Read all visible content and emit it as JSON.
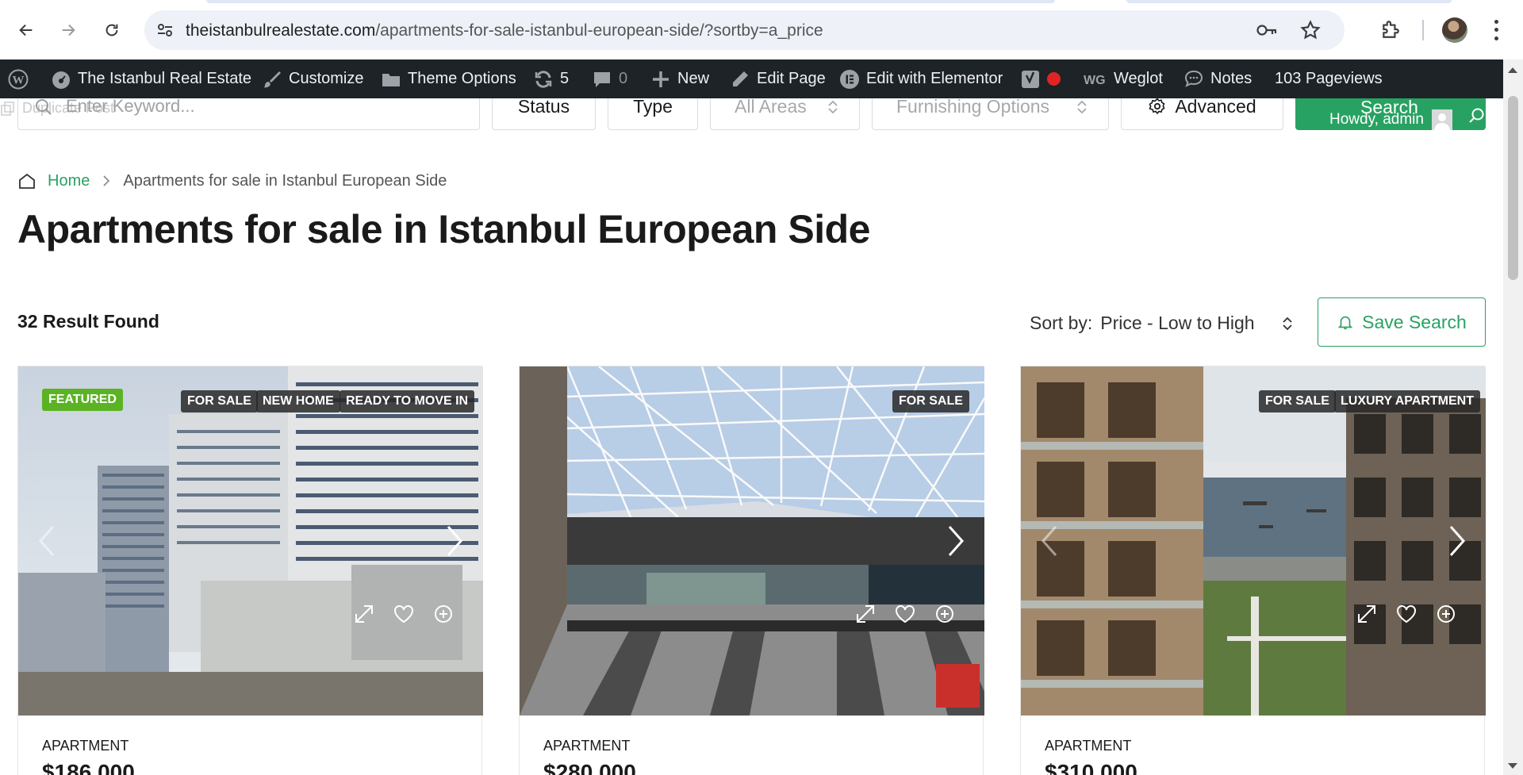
{
  "browser": {
    "url_host": "theistanbulrealestate.com",
    "url_path": "/apartments-for-sale-istanbul-european-side/?sortby=a_price"
  },
  "admin_bar": {
    "site_name": "The Istanbul Real Estate",
    "customize": "Customize",
    "theme_options": "Theme Options",
    "updates_count": "5",
    "comments_count": "0",
    "new": "New",
    "edit_page": "Edit Page",
    "edit_elementor": "Edit with Elementor",
    "weglot": "Weglot",
    "notes": "Notes",
    "pageviews": "103 Pageviews"
  },
  "search": {
    "keyword_placeholder": "Enter Keyword...",
    "duplicate_post": "Duplicate Post",
    "status": "Status",
    "type": "Type",
    "areas": "All Areas",
    "furnishing": "Furnishing Options",
    "advanced": "Advanced",
    "button": "Search",
    "howdy": "Howdy, admin"
  },
  "breadcrumb": {
    "home": "Home",
    "current": "Apartments for sale in Istanbul European Side"
  },
  "page_title": "Apartments for sale in Istanbul European Side",
  "results": {
    "count_label": "32 Result Found",
    "sort_label": "Sort by:",
    "sort_value": "Price - Low to High",
    "save_search": "Save Search"
  },
  "listings": [
    {
      "featured": "FEATURED",
      "badges": [
        "FOR SALE",
        "NEW HOME",
        "READY TO MOVE IN"
      ],
      "type": "APARTMENT",
      "price": "$186,000"
    },
    {
      "badges": [
        "FOR SALE"
      ],
      "type": "APARTMENT",
      "price": "$280,000"
    },
    {
      "badges": [
        "FOR SALE",
        "LUXURY APARTMENT"
      ],
      "type": "APARTMENT",
      "price": "$310,000"
    }
  ],
  "colors": {
    "accent_green": "#28a262",
    "featured_green": "#5bb324",
    "admin_bar": "#1d2327"
  }
}
